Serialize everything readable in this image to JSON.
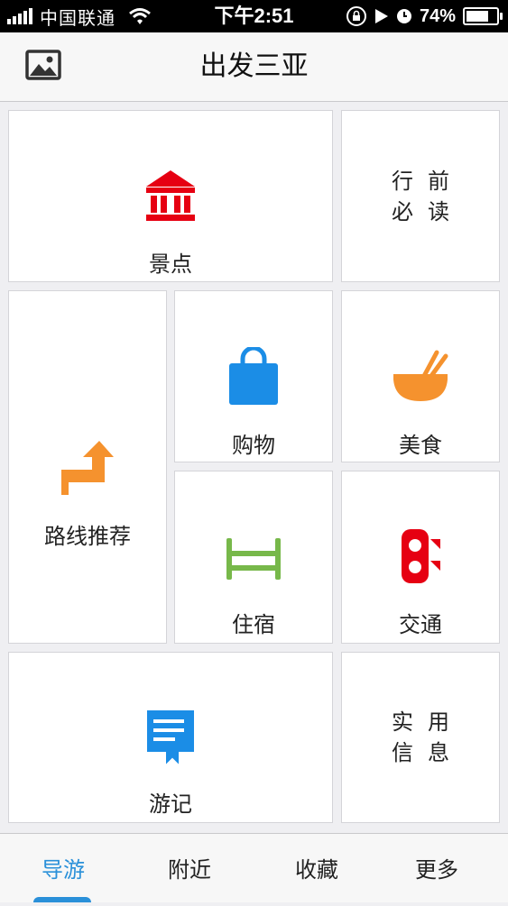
{
  "status_bar": {
    "carrier": "中国联通",
    "time": "下午2:51",
    "battery": "74%",
    "battery_level": 0.74
  },
  "header": {
    "title": "出发三亚",
    "left_icon": "image-icon"
  },
  "tiles": {
    "attractions": {
      "label": "景点",
      "icon": "landmark-icon",
      "color": "#e60012"
    },
    "pre_trip": {
      "line1": "行前",
      "line2": "必读"
    },
    "routes": {
      "label": "路线推荐",
      "icon": "route-arrow-icon",
      "color": "#f5922e"
    },
    "shopping": {
      "label": "购物",
      "icon": "shopping-bag-icon",
      "color": "#1b8de6"
    },
    "food": {
      "label": "美食",
      "icon": "food-bowl-icon",
      "color": "#f5922e"
    },
    "lodging": {
      "label": "住宿",
      "icon": "bed-icon",
      "color": "#77b84a"
    },
    "transport": {
      "label": "交通",
      "icon": "traffic-light-icon",
      "color": "#e60012"
    },
    "travel_notes": {
      "label": "游记",
      "icon": "travel-note-icon",
      "color": "#1b8de6"
    },
    "practical_info": {
      "line1": "实用",
      "line2": "信息"
    }
  },
  "bottom_nav": {
    "items": [
      "导游",
      "附近",
      "收藏",
      "更多"
    ],
    "active_index": 0,
    "accent": "#2a90d9"
  }
}
